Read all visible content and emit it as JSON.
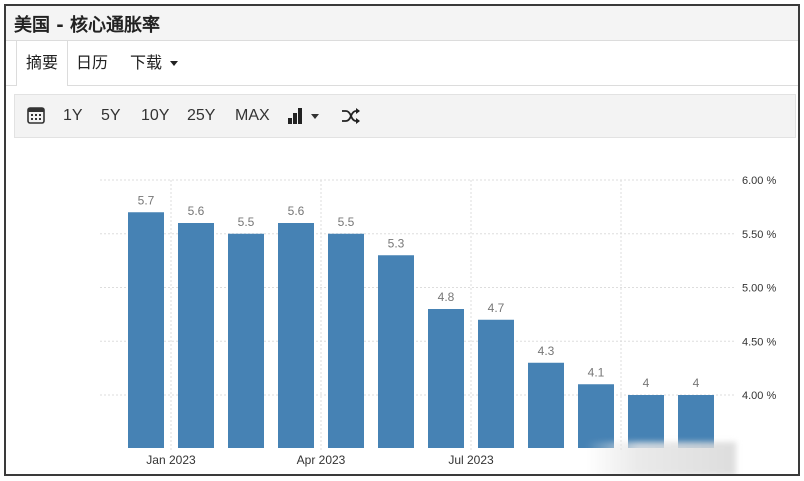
{
  "header": {
    "title": "美国 - 核心通胀率"
  },
  "tabs": [
    {
      "label": "摘要"
    },
    {
      "label": "日历"
    },
    {
      "label": "下载"
    }
  ],
  "toolbar": {
    "ranges": [
      "1Y",
      "5Y",
      "10Y",
      "25Y",
      "MAX"
    ],
    "icons": [
      "calendar-icon",
      "bar-chart-icon",
      "shuffle-icon"
    ]
  },
  "colors": {
    "bar": "#4682b4",
    "grid": "#dddddd",
    "label": "#777777",
    "axis_text": "#333333"
  },
  "chart_data": {
    "type": "bar",
    "values": [
      5.7,
      5.6,
      5.5,
      5.6,
      5.5,
      5.3,
      4.8,
      4.7,
      4.3,
      4.1,
      4,
      4
    ],
    "data_labels": [
      "5.7",
      "5.6",
      "5.5",
      "5.6",
      "5.5",
      "5.3",
      "4.8",
      "4.7",
      "4.3",
      "4.1",
      "4",
      "4"
    ],
    "x_ticks": [
      {
        "label": "Jan 2023",
        "between": [
          0,
          1
        ]
      },
      {
        "label": "Apr 2023",
        "between": [
          3,
          4
        ]
      },
      {
        "label": "Jul 2023",
        "between": [
          6,
          7
        ]
      },
      {
        "label": "",
        "between": [
          9,
          10
        ]
      }
    ],
    "y_ticks": [
      6.0,
      5.5,
      5.0,
      4.5,
      4.0
    ],
    "y_tick_labels": [
      "6.00 %",
      "5.50 %",
      "5.00 %",
      "4.50 %",
      "4.00 %"
    ],
    "ylim": [
      3.5,
      6.0
    ],
    "grid": true,
    "y_axis_position": "right"
  }
}
